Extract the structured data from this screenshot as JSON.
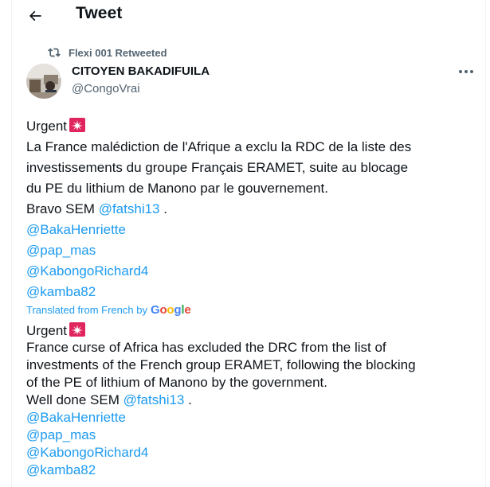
{
  "header": {
    "title": "Tweet"
  },
  "retweet": {
    "label": "Flexi 001 Retweeted"
  },
  "author": {
    "display_name": "CITOYEN BAKADIFUILA",
    "handle": "@CongoVrai"
  },
  "tweet": {
    "urgent_label": "Urgent",
    "body_lines": [
      "La France malédiction de l'Afrique a exclu la RDC de la liste des",
      "investissements du groupe Français ERAMET, suite au blocage",
      "du PE du lithium de Manono par le gouvernement."
    ],
    "bravo_prefix": "Bravo SEM ",
    "bravo_mention": "@fatshi13",
    "bravo_suffix": " .",
    "mentions": [
      "@BakaHenriette",
      "@pap_mas",
      "@KabongoRichard4",
      "@kamba82"
    ]
  },
  "translation": {
    "label": "Translated from French by",
    "provider": "Google",
    "urgent_label": "Urgent",
    "body_lines": [
      "France curse of Africa has excluded the DRC from the list of",
      "investments of the French group ERAMET, following the blocking",
      "of the PE of lithium of Manono by the government."
    ],
    "welldone_prefix": "Well done SEM ",
    "welldone_mention": "@fatshi13",
    "welldone_suffix": " .",
    "mentions": [
      "@BakaHenriette",
      "@pap_mas",
      "@KabongoRichard4",
      "@kamba82"
    ]
  },
  "icons": {
    "back": "arrow-left-icon",
    "retweet": "retweet-icon",
    "more": "more-horizontal-icon",
    "siren": "rotating-light-emoji"
  },
  "colors": {
    "link": "#1d9bf0",
    "muted": "#536471",
    "text": "#0f1419"
  }
}
